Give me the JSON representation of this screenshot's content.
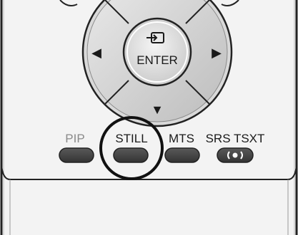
{
  "dpad": {
    "enter_label": "ENTER",
    "enter_icon": "enter-input-icon",
    "left_arrow": "◀",
    "right_arrow": "▶",
    "down_arrow": "▼"
  },
  "buttons": [
    {
      "id": "pip",
      "label": "PIP",
      "muted": true
    },
    {
      "id": "still",
      "label": "STILL",
      "highlighted": true
    },
    {
      "id": "mts",
      "label": "MTS"
    },
    {
      "id": "srs-tsxt",
      "label": "SRS TSXT",
      "icon": "srs-surround-icon"
    }
  ],
  "colors": {
    "body": "#f2f2f2",
    "outline": "#222222",
    "button_dark": "#4a4a4a",
    "label_muted": "#8a8a8a"
  }
}
